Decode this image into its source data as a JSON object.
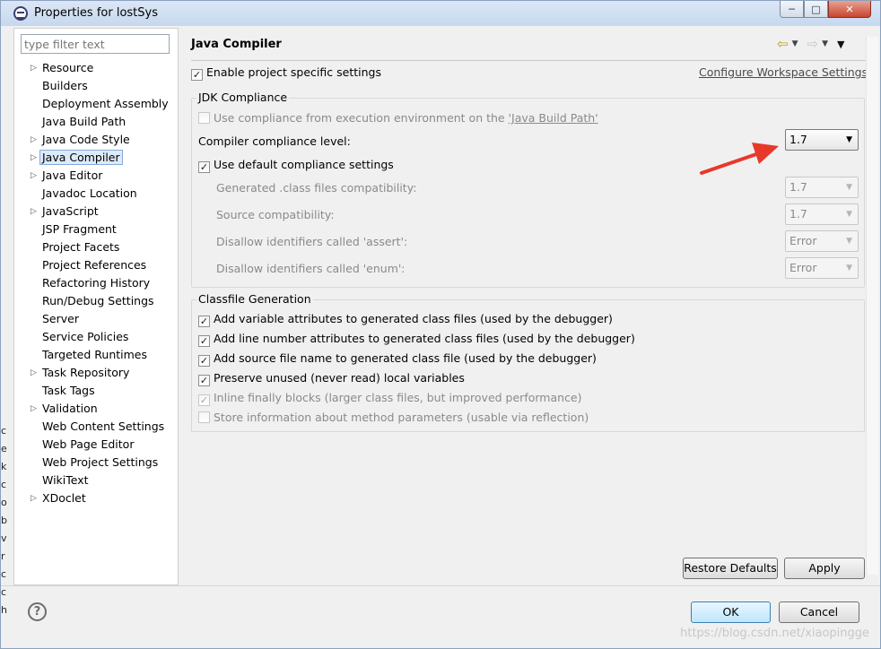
{
  "window": {
    "title": "Properties for lostSys",
    "minimize": "─",
    "maximize": "□",
    "close": "✕"
  },
  "filter": {
    "placeholder": "type filter text"
  },
  "tree": [
    {
      "label": "Resource",
      "expandable": true
    },
    {
      "label": "Builders",
      "expandable": false
    },
    {
      "label": "Deployment Assembly",
      "expandable": false
    },
    {
      "label": "Java Build Path",
      "expandable": false
    },
    {
      "label": "Java Code Style",
      "expandable": true
    },
    {
      "label": "Java Compiler",
      "expandable": true,
      "selected": true
    },
    {
      "label": "Java Editor",
      "expandable": true
    },
    {
      "label": "Javadoc Location",
      "expandable": false
    },
    {
      "label": "JavaScript",
      "expandable": true
    },
    {
      "label": "JSP Fragment",
      "expandable": false
    },
    {
      "label": "Project Facets",
      "expandable": false
    },
    {
      "label": "Project References",
      "expandable": false
    },
    {
      "label": "Refactoring History",
      "expandable": false
    },
    {
      "label": "Run/Debug Settings",
      "expandable": false
    },
    {
      "label": "Server",
      "expandable": false
    },
    {
      "label": "Service Policies",
      "expandable": false
    },
    {
      "label": "Targeted Runtimes",
      "expandable": false
    },
    {
      "label": "Task Repository",
      "expandable": true
    },
    {
      "label": "Task Tags",
      "expandable": false
    },
    {
      "label": "Validation",
      "expandable": true
    },
    {
      "label": "Web Content Settings",
      "expandable": false
    },
    {
      "label": "Web Page Editor",
      "expandable": false
    },
    {
      "label": "Web Project Settings",
      "expandable": false
    },
    {
      "label": "WikiText",
      "expandable": false
    },
    {
      "label": "XDoclet",
      "expandable": true
    }
  ],
  "page": {
    "title": "Java Compiler",
    "enable_specific": "Enable project specific settings",
    "configure_link": "Configure Workspace Settings..."
  },
  "jdk": {
    "group_label": "JDK Compliance",
    "use_env_prefix": "Use compliance from execution environment on the ",
    "use_env_link": "'Java Build Path'",
    "level_label": "Compiler compliance level:",
    "level_value": "1.7",
    "use_default": "Use default compliance settings",
    "generated_label": "Generated .class files compatibility:",
    "generated_value": "1.7",
    "source_label": "Source compatibility:",
    "source_value": "1.7",
    "assert_label": "Disallow identifiers called 'assert':",
    "assert_value": "Error",
    "enum_label": "Disallow identifiers called 'enum':",
    "enum_value": "Error"
  },
  "classfile": {
    "group_label": "Classfile Generation",
    "items": [
      {
        "label": "Add variable attributes to generated class files (used by the debugger)",
        "checked": true,
        "enabled": true
      },
      {
        "label": "Add line number attributes to generated class files (used by the debugger)",
        "checked": true,
        "enabled": true
      },
      {
        "label": "Add source file name to generated class file (used by the debugger)",
        "checked": true,
        "enabled": true
      },
      {
        "label": "Preserve unused (never read) local variables",
        "checked": true,
        "enabled": true
      },
      {
        "label": "Inline finally blocks (larger class files, but improved performance)",
        "checked": true,
        "enabled": false
      },
      {
        "label": "Store information about method parameters (usable via reflection)",
        "checked": false,
        "enabled": false
      }
    ]
  },
  "buttons": {
    "restore_defaults": "Restore Defaults",
    "apply": "Apply",
    "ok": "OK",
    "cancel": "Cancel",
    "help": "?"
  },
  "watermark": "https://blog.csdn.net/xiaopingge",
  "colors": {
    "annotation_arrow": "#e8382a",
    "selection": "#ddeaf8"
  }
}
